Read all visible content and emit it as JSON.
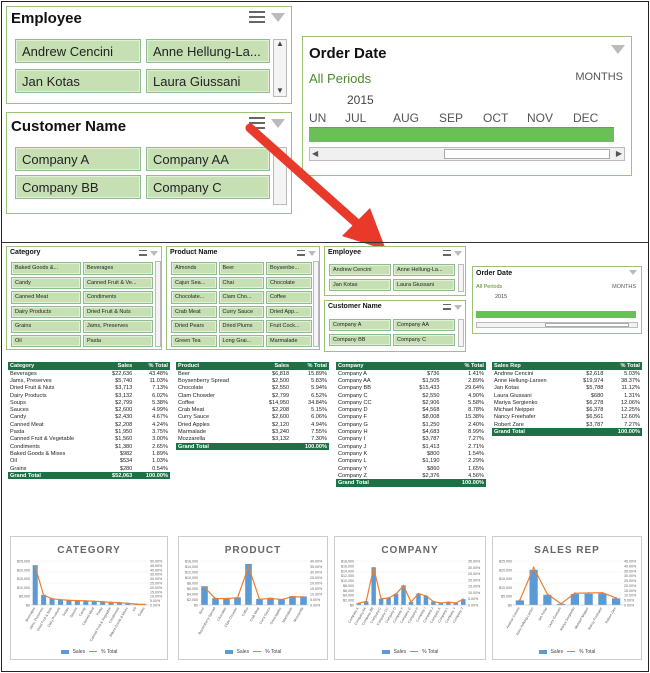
{
  "zoom": {
    "employee": {
      "title": "Employee",
      "items": [
        "Andrew Cencini",
        "Anne Hellung-La...",
        "Jan Kotas",
        "Laura Giussani"
      ]
    },
    "customer": {
      "title": "Customer Name",
      "items": [
        "Company A",
        "Company AA",
        "Company BB",
        "Company C"
      ]
    },
    "orderdate": {
      "title": "Order Date",
      "all_periods": "All Periods",
      "level": "MONTHS",
      "year": "2015",
      "months": [
        "UN",
        "JUL",
        "AUG",
        "SEP",
        "OCT",
        "NOV",
        "DEC"
      ]
    }
  },
  "dash": {
    "category": {
      "title": "Category",
      "items": [
        "Baked Goods &...",
        "Beverages",
        "Candy",
        "Canned Fruit & Ve...",
        "Canned Meat",
        "Condiments",
        "Dairy Products",
        "Dried Fruit & Nuts",
        "Grains",
        "Jams, Preserves",
        "Oil",
        "Pasta"
      ]
    },
    "product": {
      "title": "Product Name",
      "items": [
        "Almonds",
        "Beer",
        "Boysenbe...",
        "Cajun Sea...",
        "Chai",
        "Chocolate",
        "Chocolate...",
        "Clam Cho...",
        "Coffee",
        "Crab Meat",
        "Curry Sauce",
        "Dried App...",
        "Dried Pears",
        "Dried Plums",
        "Fruit Cock...",
        "Green Tea",
        "Long Grai...",
        "Marmalade"
      ]
    },
    "employee": {
      "title": "Employee",
      "items": [
        "Andrew Cencini",
        "Anne Hellung-La...",
        "Jan Kotas",
        "Laura Giussani"
      ]
    },
    "customer": {
      "title": "Customer Name",
      "items": [
        "Company A",
        "Company AA",
        "Company BB",
        "Company C"
      ]
    },
    "orderdate": {
      "title": "Order Date",
      "all_periods": "All Periods",
      "level": "MONTHS",
      "year": "2015"
    }
  },
  "tables": {
    "category": {
      "headers": [
        "Category",
        "Sales",
        "% Total"
      ],
      "rows": [
        [
          "Beverages",
          "$22,636",
          "43.48%"
        ],
        [
          "Jams, Preserves",
          "$5,740",
          "11.03%"
        ],
        [
          "Dried Fruit & Nuts",
          "$3,713",
          "7.13%"
        ],
        [
          "Dairy Products",
          "$3,132",
          "6.02%"
        ],
        [
          "Soups",
          "$2,799",
          "5.38%"
        ],
        [
          "Sauces",
          "$2,600",
          "4.99%"
        ],
        [
          "Candy",
          "$2,430",
          "4.67%"
        ],
        [
          "Canned Meat",
          "$2,208",
          "4.24%"
        ],
        [
          "Pasta",
          "$1,950",
          "3.75%"
        ],
        [
          "Canned Fruit & Vegetable",
          "$1,560",
          "3.00%"
        ],
        [
          "Condiments",
          "$1,380",
          "2.65%"
        ],
        [
          "Baked Goods & Mixes",
          "$982",
          "1.89%"
        ],
        [
          "Oil",
          "$534",
          "1.03%"
        ],
        [
          "Grains",
          "$280",
          "0.54%"
        ]
      ],
      "total": [
        "Grand Total",
        "$52,063",
        "100.00%"
      ]
    },
    "product": {
      "headers": [
        "Product",
        "Sales",
        "% Total"
      ],
      "rows": [
        [
          "Beer",
          "$6,818",
          "15.89%"
        ],
        [
          "Boysenberry Spread",
          "$2,500",
          "5.83%"
        ],
        [
          "Chocolate",
          "$2,550",
          "5.94%"
        ],
        [
          "Clam Chowder",
          "$2,799",
          "6.52%"
        ],
        [
          "Coffee",
          "$14,950",
          "34.84%"
        ],
        [
          "Crab Meat",
          "$2,208",
          "5.15%"
        ],
        [
          "Curry Sauce",
          "$2,600",
          "6.06%"
        ],
        [
          "Dried Apples",
          "$2,120",
          "4.94%"
        ],
        [
          "Marmalade",
          "$3,240",
          "7.55%"
        ],
        [
          "Mozzarella",
          "$3,132",
          "7.30%"
        ]
      ],
      "total": [
        "Grand Total",
        "",
        "100.00%"
      ]
    },
    "company": {
      "headers": [
        "Company",
        "",
        "% Total"
      ],
      "rows": [
        [
          "Company A",
          "$736",
          "1.41%"
        ],
        [
          "Company AA",
          "$1,505",
          "2.89%"
        ],
        [
          "Company BB",
          "$15,433",
          "29.64%"
        ],
        [
          "Company C",
          "$2,550",
          "4.90%"
        ],
        [
          "Company CC",
          "$2,906",
          "5.58%"
        ],
        [
          "Company D",
          "$4,568",
          "8.78%"
        ],
        [
          "Company F",
          "$8,008",
          "15.38%"
        ],
        [
          "Company G",
          "$1,250",
          "2.40%"
        ],
        [
          "Company H",
          "$4,683",
          "8.99%"
        ],
        [
          "Company I",
          "$3,787",
          "7.27%"
        ],
        [
          "Company J",
          "$1,413",
          "2.71%"
        ],
        [
          "Company K",
          "$800",
          "1.54%"
        ],
        [
          "Company L",
          "$1,190",
          "2.29%"
        ],
        [
          "Company Y",
          "$860",
          "1.65%"
        ],
        [
          "Company Z",
          "$2,376",
          "4.56%"
        ]
      ],
      "total": [
        "Grand Total",
        "",
        "100.00%"
      ]
    },
    "salesrep": {
      "headers": [
        "Sales Rep",
        "",
        "% Total"
      ],
      "rows": [
        [
          "Andrew Cencini",
          "$2,618",
          "5.03%"
        ],
        [
          "Anne Hellung-Larsen",
          "$19,974",
          "38.37%"
        ],
        [
          "Jan Kotas",
          "$5,788",
          "11.12%"
        ],
        [
          "Laura Giussani",
          "$680",
          "1.31%"
        ],
        [
          "Mariya Sergienko",
          "$6,278",
          "12.06%"
        ],
        [
          "Michael Neipper",
          "$6,378",
          "12.25%"
        ],
        [
          "Nancy Freehafer",
          "$6,561",
          "12.60%"
        ],
        [
          "Robert Zare",
          "$3,787",
          "7.27%"
        ]
      ],
      "total": [
        "Grand Total",
        "",
        "100.00%"
      ]
    }
  },
  "charts_text": {
    "category_title": "CATEGORY",
    "product_title": "PRODUCT",
    "company_title": "COMPANY",
    "salesrep_title": "SALES REP",
    "legend_sales": "Sales",
    "legend_pct": "% Total"
  },
  "chart_data": [
    {
      "type": "bar",
      "title": "CATEGORY",
      "categories": [
        "Beverages",
        "Jams, Preserves",
        "Dried Fruit & Nuts",
        "Dairy Products",
        "Soups",
        "Sauces",
        "Candy",
        "Canned Meat",
        "Pasta",
        "Canned Fruit & Vegetable",
        "Condiments",
        "Baked Goods & Mixes",
        "Oil",
        "Grains"
      ],
      "series": [
        {
          "name": "Sales",
          "values": [
            22636,
            5740,
            3713,
            3132,
            2799,
            2600,
            2430,
            2208,
            1950,
            1560,
            1380,
            982,
            534,
            280
          ]
        },
        {
          "name": "% Total",
          "values": [
            43.48,
            11.03,
            7.13,
            6.02,
            5.38,
            4.99,
            4.67,
            4.24,
            3.75,
            3.0,
            2.65,
            1.89,
            1.03,
            0.54
          ]
        }
      ],
      "ylim": [
        0,
        25000
      ],
      "y2lim": [
        0,
        50
      ],
      "yticks": [
        "$25,000",
        "$20,000",
        "$15,000",
        "$10,000",
        "$5,000",
        "$0"
      ],
      "y2ticks": [
        "50.00%",
        "45.00%",
        "40.00%",
        "35.00%",
        "30.00%",
        "25.00%",
        "20.00%",
        "15.00%",
        "10.00%",
        "5.00%",
        "0.00%"
      ]
    },
    {
      "type": "bar",
      "title": "PRODUCT",
      "categories": [
        "Beer",
        "Boysenberry Spread",
        "Chocolate",
        "Clam Chowder",
        "Coffee",
        "Crab Meat",
        "Curry Sauce",
        "Dried Apples",
        "Marmalade",
        "Mozzarella"
      ],
      "series": [
        {
          "name": "Sales",
          "values": [
            6818,
            2500,
            2550,
            2799,
            14950,
            2208,
            2600,
            2120,
            3240,
            3132
          ]
        },
        {
          "name": "% Total",
          "values": [
            15.89,
            5.83,
            5.94,
            6.52,
            34.84,
            5.15,
            6.06,
            4.94,
            7.55,
            7.3
          ]
        }
      ],
      "ylim": [
        0,
        16000
      ],
      "y2lim": [
        0,
        40
      ],
      "yticks": [
        "$16,000",
        "$14,000",
        "$12,000",
        "$10,000",
        "$8,000",
        "$6,000",
        "$4,000",
        "$2,000",
        "$0"
      ],
      "y2ticks": [
        "40.00%",
        "35.00%",
        "30.00%",
        "25.00%",
        "20.00%",
        "15.00%",
        "10.00%",
        "5.00%",
        "0.00%"
      ]
    },
    {
      "type": "bar",
      "title": "COMPANY",
      "categories": [
        "Company A",
        "Company AA",
        "Company BB",
        "Company C",
        "Company CC",
        "Company D",
        "Company F",
        "Company G",
        "Company H",
        "Company I",
        "Company J",
        "Company K",
        "Company L",
        "Company Y",
        "Company Z"
      ],
      "series": [
        {
          "name": "Sales",
          "values": [
            736,
            1505,
            15433,
            2550,
            2906,
            4568,
            8008,
            1250,
            4683,
            3787,
            1413,
            800,
            1190,
            860,
            2376
          ]
        },
        {
          "name": "% Total",
          "values": [
            1.41,
            2.89,
            29.64,
            4.9,
            5.58,
            8.78,
            15.38,
            2.4,
            8.99,
            7.27,
            2.71,
            1.54,
            2.29,
            1.65,
            4.56
          ]
        }
      ],
      "ylim": [
        0,
        18000
      ],
      "y2lim": [
        0,
        35
      ],
      "yticks": [
        "$18,000",
        "$16,000",
        "$14,000",
        "$12,000",
        "$10,000",
        "$8,000",
        "$6,000",
        "$4,000",
        "$2,000",
        "$0"
      ],
      "y2ticks": [
        "35.00%",
        "30.00%",
        "25.00%",
        "20.00%",
        "15.00%",
        "10.00%",
        "5.00%",
        "0.00%"
      ]
    },
    {
      "type": "bar",
      "title": "SALES REP",
      "categories": [
        "Andrew Cencini",
        "Anne Hellung-Larsen",
        "Jan Kotas",
        "Laura Giussani",
        "Mariya Sergienko",
        "Michael Neipper",
        "Nancy Freehafer",
        "Robert Zare"
      ],
      "series": [
        {
          "name": "Sales",
          "values": [
            2618,
            19974,
            5788,
            680,
            6278,
            6378,
            6561,
            3787
          ]
        },
        {
          "name": "% Total",
          "values": [
            5.03,
            38.37,
            11.12,
            1.31,
            12.06,
            12.25,
            12.6,
            7.27
          ]
        }
      ],
      "ylim": [
        0,
        25000
      ],
      "y2lim": [
        0,
        45
      ],
      "yticks": [
        "$25,000",
        "$20,000",
        "$15,000",
        "$10,000",
        "$5,000",
        "$0"
      ],
      "y2ticks": [
        "45.00%",
        "40.00%",
        "35.00%",
        "30.00%",
        "25.00%",
        "20.00%",
        "15.00%",
        "10.00%",
        "5.00%",
        "0.00%"
      ]
    }
  ],
  "colors": {
    "accent": "#1e7145",
    "bar": "#5b9bd5",
    "line": "#ed7d31",
    "arrow": "#e8392b",
    "slicer_btn": "#c6e0b4"
  }
}
